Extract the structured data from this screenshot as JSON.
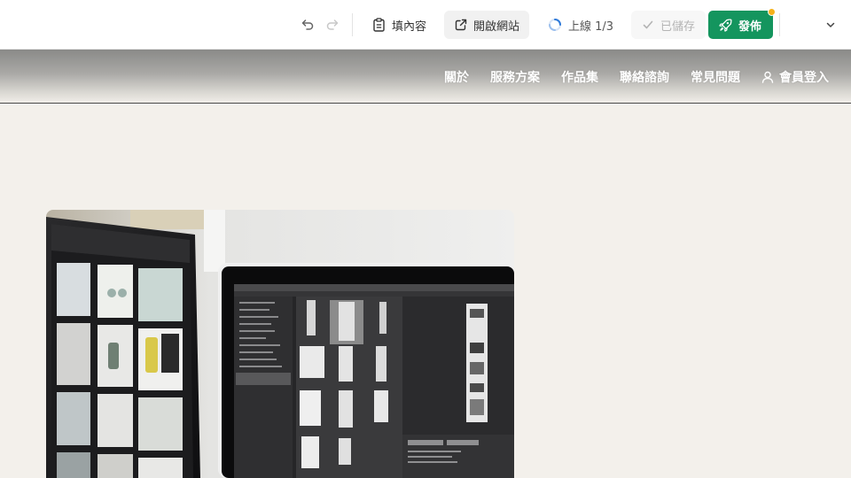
{
  "toolbar": {
    "undo_icon": "undo-icon",
    "redo_icon": "redo-icon",
    "fill_content_label": "填內容",
    "open_site_label": "開啟網站",
    "online_status_label": "上線 1/3",
    "saved_label": "已儲存",
    "publish_label": "發佈",
    "publish_badge_color": "#f6b21b",
    "publish_color": "#14955e"
  },
  "nav": {
    "about": "關於",
    "services": "服務方案",
    "works": "作品集",
    "contact": "聯絡諮詢",
    "faq": "常見問題",
    "login": "會員登入"
  }
}
